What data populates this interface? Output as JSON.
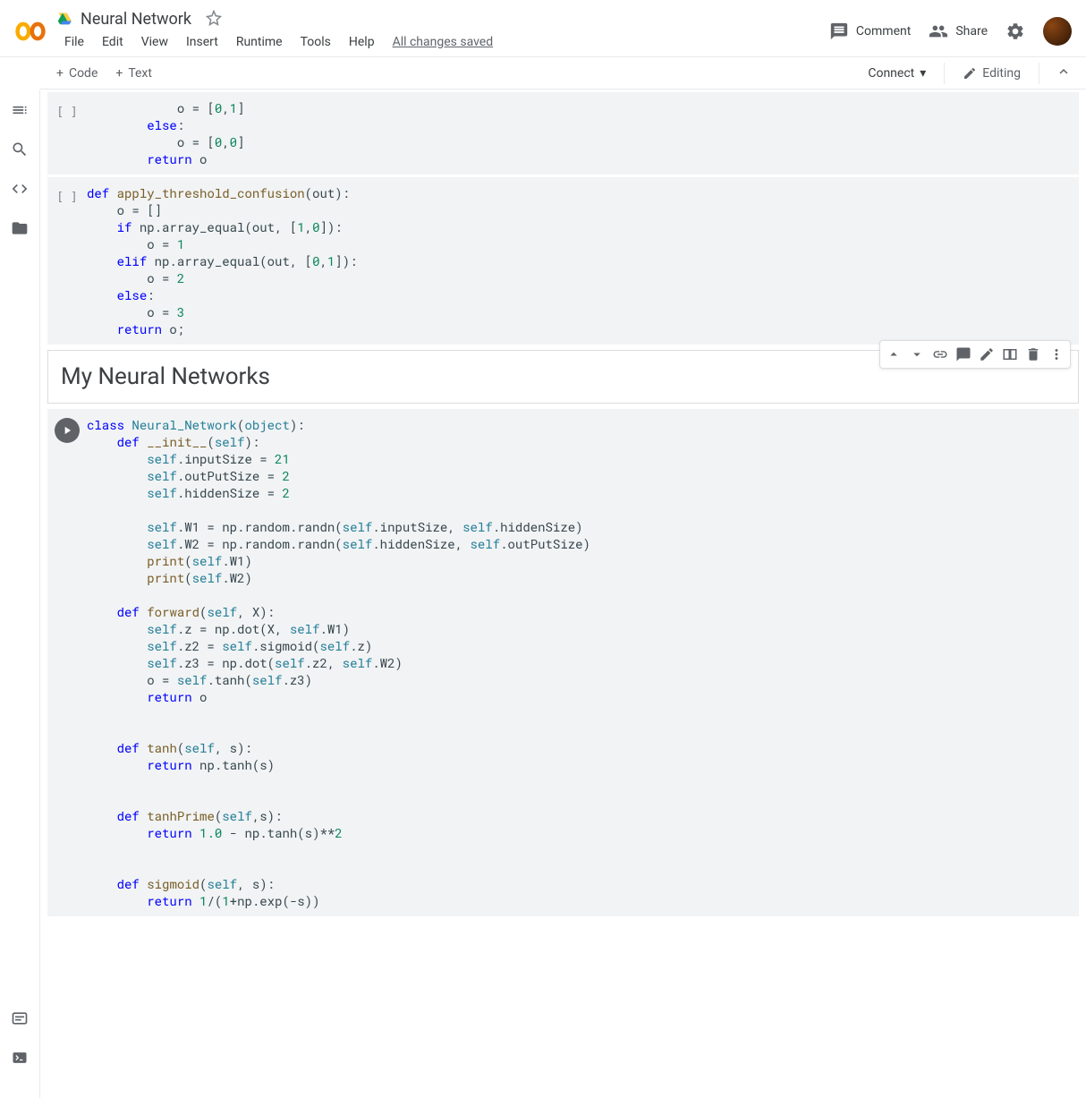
{
  "header": {
    "doc_title": "Neural Network",
    "menu": [
      "File",
      "Edit",
      "View",
      "Insert",
      "Runtime",
      "Tools",
      "Help"
    ],
    "save_status": "All changes saved",
    "comment_label": "Comment",
    "share_label": "Share"
  },
  "toolbar": {
    "add_code": "Code",
    "add_text": "Text",
    "connect": "Connect",
    "editing": "Editing"
  },
  "cells": {
    "cell0_gutter": "[ ]",
    "cell1_gutter": "[ ]",
    "text_heading": "My Neural Networks"
  },
  "code": {
    "cell0": {
      "l1a": "            o ",
      "l1b": "= ",
      "l1c": "[",
      "l1d": "0",
      "l1e": ",",
      "l1f": "1",
      "l1g": "]",
      "l2a": "        ",
      "l2b": "else",
      "l2c": ":",
      "l3a": "            o ",
      "l3b": "= ",
      "l3c": "[",
      "l3d": "0",
      "l3e": ",",
      "l3f": "0",
      "l3g": "]",
      "l4a": "        ",
      "l4b": "return",
      "l4c": " o"
    },
    "cell1": {
      "l1a": "def",
      "l1b": " ",
      "l1c": "apply_threshold_confusion",
      "l1d": "(out):",
      "l2": "    o = []",
      "l3a": "    ",
      "l3b": "if",
      "l3c": " np.array_equal(out, [",
      "l3d": "1",
      "l3e": ",",
      "l3f": "0",
      "l3g": "]):",
      "l4a": "        o ",
      "l4b": "= ",
      "l4c": "1",
      "l5a": "    ",
      "l5b": "elif",
      "l5c": " np.array_equal(out, [",
      "l5d": "0",
      "l5e": ",",
      "l5f": "1",
      "l5g": "]):",
      "l6a": "        o ",
      "l6b": "= ",
      "l6c": "2",
      "l7a": "    ",
      "l7b": "else",
      "l7c": ":",
      "l8a": "        o ",
      "l8b": "= ",
      "l8c": "3",
      "l9a": "    ",
      "l9b": "return",
      "l9c": " o;"
    },
    "cell2": {
      "l1a": "class",
      "l1b": " ",
      "l1c": "Neural_Network",
      "l1d": "(",
      "l1e": "object",
      "l1f": "):",
      "l2a": "    ",
      "l2b": "def",
      "l2c": " ",
      "l2d": "__init__",
      "l2e": "(",
      "l2f": "self",
      "l2g": "):",
      "l3a": "        ",
      "l3b": "self",
      "l3c": ".inputSize = ",
      "l3d": "21",
      "l4a": "        ",
      "l4b": "self",
      "l4c": ".outPutSize = ",
      "l4d": "2",
      "l5a": "        ",
      "l5b": "self",
      "l5c": ".hiddenSize = ",
      "l5d": "2",
      "l6": "",
      "l7a": "        ",
      "l7b": "self",
      "l7c": ".W1 = np.random.randn(",
      "l7d": "self",
      "l7e": ".inputSize, ",
      "l7f": "self",
      "l7g": ".hiddenSize)",
      "l8a": "        ",
      "l8b": "self",
      "l8c": ".W2 = np.random.randn(",
      "l8d": "self",
      "l8e": ".hiddenSize, ",
      "l8f": "self",
      "l8g": ".outPutSize)",
      "l9a": "        ",
      "l9b": "print",
      "l9c": "(",
      "l9d": "self",
      "l9e": ".W1)",
      "l10a": "        ",
      "l10b": "print",
      "l10c": "(",
      "l10d": "self",
      "l10e": ".W2)",
      "l11": "",
      "l12a": "    ",
      "l12b": "def",
      "l12c": " ",
      "l12d": "forward",
      "l12e": "(",
      "l12f": "self",
      "l12g": ", X):",
      "l13a": "        ",
      "l13b": "self",
      "l13c": ".z = np.dot(X, ",
      "l13d": "self",
      "l13e": ".W1)",
      "l14a": "        ",
      "l14b": "self",
      "l14c": ".z2 = ",
      "l14d": "self",
      "l14e": ".sigmoid(",
      "l14f": "self",
      "l14g": ".z)",
      "l15a": "        ",
      "l15b": "self",
      "l15c": ".z3 = np.dot(",
      "l15d": "self",
      "l15e": ".z2, ",
      "l15f": "self",
      "l15g": ".W2)",
      "l16a": "        o = ",
      "l16b": "self",
      "l16c": ".tanh(",
      "l16d": "self",
      "l16e": ".z3)",
      "l17a": "        ",
      "l17b": "return",
      "l17c": " o",
      "l18": "",
      "l19": "",
      "l20a": "    ",
      "l20b": "def",
      "l20c": " ",
      "l20d": "tanh",
      "l20e": "(",
      "l20f": "self",
      "l20g": ", s):",
      "l21a": "        ",
      "l21b": "return",
      "l21c": " np.tanh(s)",
      "l22": "",
      "l23": "",
      "l24a": "    ",
      "l24b": "def",
      "l24c": " ",
      "l24d": "tanhPrime",
      "l24e": "(",
      "l24f": "self",
      "l24g": ",s):",
      "l25a": "        ",
      "l25b": "return",
      "l25c": " ",
      "l25d": "1.0",
      "l25e": " - np.tanh(s)**",
      "l25f": "2",
      "l26": "",
      "l27": "",
      "l28a": "    ",
      "l28b": "def",
      "l28c": " ",
      "l28d": "sigmoid",
      "l28e": "(",
      "l28f": "self",
      "l28g": ", s):",
      "l29a": "        ",
      "l29b": "return",
      "l29c": " ",
      "l29d": "1",
      "l29e": "/(",
      "l29f": "1",
      "l29g": "+np.exp(-s))"
    }
  }
}
